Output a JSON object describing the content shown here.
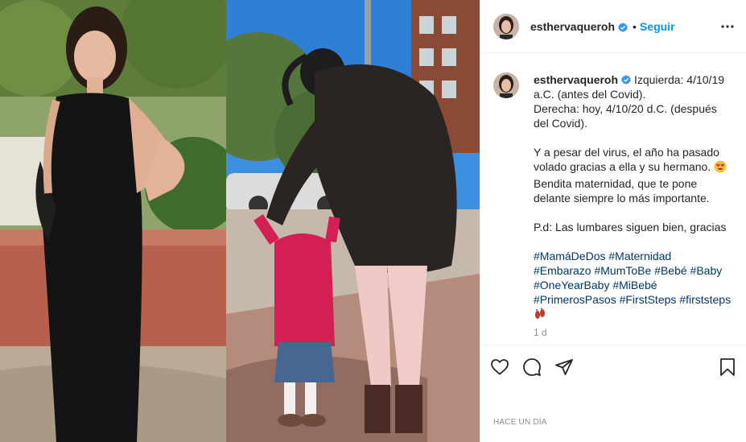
{
  "header": {
    "username": "esthervaqueroh",
    "separator": "•",
    "follow_label": "Seguir",
    "verified_icon": "verified-badge-icon",
    "more_icon": "more-options-icon"
  },
  "caption": {
    "username": "esthervaqueroh",
    "lines": [
      "Izquierda: 4/10/19",
      "a.C. (antes del Covid).",
      "Derecha: hoy, 4/10/20 d.C. (después",
      "del Covid)."
    ],
    "paragraph2": [
      "Y a pesar del virus, el año ha pasado",
      "volado gracias a ella y su hermano.",
      "Bendita maternidad, que te pone",
      "delante siempre lo más importante."
    ],
    "paragraph3": "P.d: Las lumbares siguen bien, gracias",
    "hashtag_lines": [
      "#MamáDeDos #Maternidad",
      "#Embarazo #MumToBe #Bebé #Baby",
      "#OneYearBaby #MiBebé",
      "#PrimerosPasos #FirstSteps #firststeps"
    ],
    "emoji_heart_eyes": "heart-eyes-emoji",
    "emoji_footprints": "footprints-emoji",
    "age": "1 d"
  },
  "actions": {
    "like_icon": "heart-icon",
    "comment_icon": "comment-icon",
    "share_icon": "send-icon",
    "save_icon": "bookmark-icon"
  },
  "date_label": "HACE UN DÍA",
  "colors": {
    "link": "#0095f6",
    "hashtag": "#00376b",
    "muted": "#8e8e8e",
    "border": "#efefef"
  }
}
